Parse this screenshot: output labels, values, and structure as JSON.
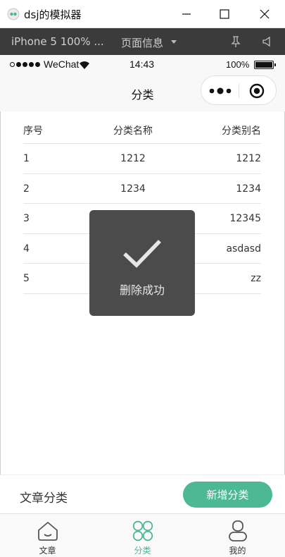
{
  "window": {
    "title": "dsj的模拟器",
    "logo_icon": "wechat-devtools-logo",
    "controls": [
      "minimize-icon",
      "maximize-icon",
      "close-icon"
    ]
  },
  "toolbar": {
    "device": "iPhone 5 100% ...",
    "page_info": "页面信息"
  },
  "status_bar": {
    "carrier": "WeChat",
    "time": "14:43",
    "battery": "100%"
  },
  "navbar": {
    "title": "分类"
  },
  "table": {
    "headers": [
      "序号",
      "分类名称",
      "分类别名"
    ],
    "rows": [
      [
        "1",
        "1212",
        "1212"
      ],
      [
        "2",
        "1234",
        "1234"
      ],
      [
        "3",
        "",
        "12345"
      ],
      [
        "4",
        "",
        "asdasd"
      ],
      [
        "5",
        "",
        "zz"
      ]
    ]
  },
  "toast": {
    "text": "删除成功",
    "icon": "checkmark-icon"
  },
  "action_bar": {
    "label": "文章分类",
    "button": "新增分类"
  },
  "tabs": [
    {
      "label": "文章",
      "icon": "house-icon",
      "active": false
    },
    {
      "label": "分类",
      "icon": "grid-icon",
      "active": true
    },
    {
      "label": "我的",
      "icon": "user-icon",
      "active": false
    }
  ],
  "colors": {
    "accent": "#4cb894",
    "toolbar_bg": "#3b3b3b",
    "toast_bg": "#3c3c3c"
  }
}
